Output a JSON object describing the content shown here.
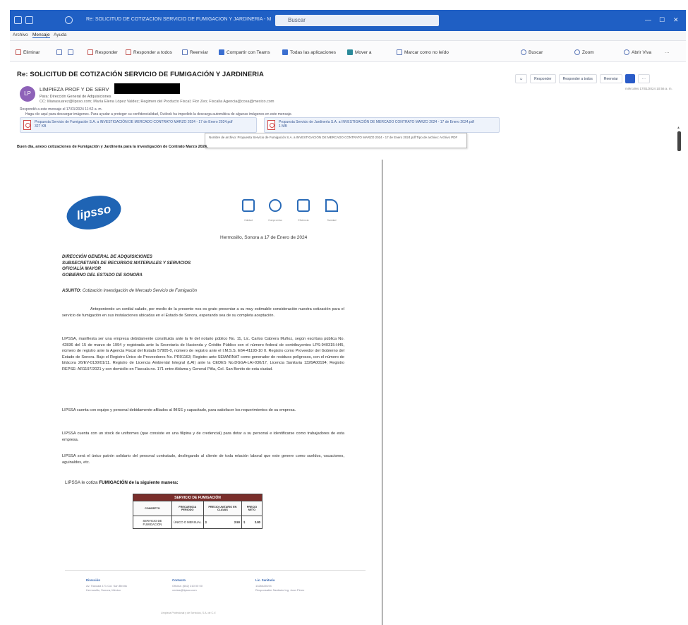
{
  "window": {
    "title": "Re: SOLICITUD DE COTIZACION SERVICIO DE FUMIGACION Y JARDINERIA - Mensaje (HTML)",
    "search_placeholder": "Buscar",
    "controls": [
      "—",
      "☐",
      "✕"
    ]
  },
  "menu": {
    "items": [
      "Archivo",
      "Mensaje",
      "Ayuda"
    ]
  },
  "ribbon": {
    "buttons": [
      {
        "label": "Eliminar",
        "icon": "delete-icon"
      },
      {
        "label": "",
        "icon": "archive-icon"
      },
      {
        "label": "",
        "icon": "move-icon"
      },
      {
        "label": "Responder",
        "icon": "reply-icon"
      },
      {
        "label": "Responder a todos",
        "icon": "reply-all-icon"
      },
      {
        "label": "Reenviar",
        "icon": "forward-icon"
      },
      {
        "label": "Compartir con Teams",
        "icon": "teams-icon"
      },
      {
        "label": "Todas las aplicaciones",
        "icon": "apps-icon"
      },
      {
        "label": "Mover a",
        "icon": "folder-icon"
      },
      {
        "label": "Marcar como no leído",
        "icon": "unread-icon"
      },
      {
        "label": "Buscar",
        "icon": "search-icon"
      },
      {
        "label": "Zoom",
        "icon": "zoom-icon"
      },
      {
        "label": "Abrir Viva",
        "icon": "viva-icon"
      },
      {
        "label": "···",
        "icon": "more-icon"
      }
    ]
  },
  "message": {
    "subject": "Re: SOLICITUD DE COTIZACIÓN SERVICIO DE FUMIGACIÓN Y JARDINERIA",
    "avatar_initials": "LP",
    "sender": "LIMPIEZA PROF Y DE SERV",
    "to": "Para: Dirección General de Adquisiciones",
    "cc": "CC: lilianasuarez@lipsso.com; María Elena López Valdez; Regimen del Producto Fiscal; Flor Zeo; Fiscalía Agencia@cosa@mexico.com",
    "info1": "Respondió a este mensaje el 17/01/2024 11:52 a. m.",
    "info2": "Haga clic aquí para descargar imágenes. Para ayudar a proteger su confidencialidad, Outlook ha impedido la descarga automática de algunas imágenes en este mensaje.",
    "attachments": [
      {
        "name": "Propuesta Servicio de Fumigación S.A. a INVESTIGACIÓN DE MERCADO CONTRATO MARZO 2024 - 17 de Enero 2024.pdf",
        "size": "327 KB"
      },
      {
        "name": "Propuesta Servicio de Jardinería S.A. a INVESTIGACIÓN DE MERCADO CONTRATO MARZO 2024 - 17 de Enero 2024.pdf",
        "size": "1 MB"
      }
    ],
    "tooltip": "Nombre de archivo: Propuesta Servicio de Fumigación S.A. a INVESTIGACIÓN DE MERCADO CONTRATO MARZO 2024 - 17 de Enero 2024.pdf  Tipo de archivo: Archivo PDF",
    "body_line": "Buen día, anexo cotizaciones de Fumigación y Jardinería para la investigación de Contrato Marzo 2024.",
    "actions": [
      "Responder",
      "Responder a todos",
      "Reenviar"
    ],
    "timestamp": "miércoles 17/01/2024 10:56 a. m."
  },
  "document": {
    "logo_text": "lipsso",
    "cert_captions": [
      "Calidad",
      "Compromiso",
      "Eficiencia",
      "Sanidad"
    ],
    "place_date": "Hermosillo, Sonora a 17 de Enero de 2024",
    "addressee": [
      "DIRECCIÓN GENERAL DE ADQUISICIONES",
      "SUBSECRETARÍA DE RECURSOS MATERIALES Y SERVICIOS",
      "OFICIALÍA MAYOR",
      "GOBIERNO DEL ESTADO DE SONORA"
    ],
    "asunto_label": "ASUNTO:",
    "asunto_text": "Cotización Investigación de Mercado Servicio de Fumigación",
    "paragraphs": [
      "Anteponiendo un cordial saludo, por medio de la presente nos es grato presentar a su muy estimable consideración nuestra cotización para el servicio de fumigación en sus instalaciones ubicadas en el Estado de Sonora, esperando sea de su completa aceptación.",
      "LIPSSA, manifiesta ser una empresa debidamente constituida ante la fe del notario público No. 11, Lic. Carlos Cabrera Muñoz, según escritura pública No. 42836 del 15 de marzo de 1994 y registrada ante la Secretaría de Hacienda y Crédito Público con el número federal de contribuyentes LPS-940315-H45, número de registro ante la Agencia Fiscal del Estado 57905-0, número de registro ante el I.M.S.S. E64-41193-10 0. Registro como Proveedor del Gobierno del Estado de Sonora. Bajo el Registro Único de Proveedores No. PR01163; Registro ante SEMARNAT como generador de residuos peligrosos, con el número de bitácora 26/EV-0130/01/11. Registro de Licencia Ambiental Integral (LAI) ante la CEDES No.DGGA-LAI-030/17, Licencia Sanitaria 1326A00194; Registro REPSE: AR1197/2021 y con domicilio en Tlaxcala no. 171 entre Aldama y General Piña, Col. San Benito de esta ciudad.",
      "LIPSSA cuenta con equipo y personal debidamente afiliados al IMSS y capacitado, para satisfacer los requerimientos de su empresa.",
      "LIPSSA cuenta con un stock de uniformes (que consiste en una filipina y de credencial) para dotar a su personal e identificarse como trabajadores de esta empresa.",
      "LIPSSA será el único patrón solidario del personal contratado, deslingando al cliente de toda relación laboral que este genere como sueldos, vacaciones, aguinaldos, etc."
    ],
    "offer_prefix": "LIPSSA le cotiza",
    "offer_bold": "FUMIGACIÓN de la siguiente manera:",
    "table": {
      "title": "SERVICIO DE FUMIGACIÓN",
      "headers": [
        "CONCEPTO",
        "FRECUENCIA PERIODO",
        "PRECIO UNITARIO EN CLAVAS",
        "PRECIO NETO"
      ],
      "rows": [
        {
          "concepto": "SERVICIO DE FUMIGACIÓN",
          "frecuencia": "ÚNICO O MENSUAL",
          "cur1": "$",
          "unitario": "2.50",
          "cur2": "$",
          "neto": "2.80"
        }
      ]
    },
    "footer": [
      {
        "heading": "Dirección",
        "lines": [
          "Av. Tlaxcala 171 Col. San Benito",
          "Hermosillo, Sonora, México"
        ]
      },
      {
        "heading": "Contacto",
        "lines": [
          "Oficina: (662) 210 00 00",
          "ventas@lipsso.com"
        ]
      },
      {
        "heading": "Lic. Sanitaria",
        "lines": [
          "1326A00194",
          "Responsable Sanitario Ing. Juan Pérez"
        ]
      }
    ],
    "page_footer": "Limpieza Profesional y de Servicios, S.A. de C.V."
  }
}
